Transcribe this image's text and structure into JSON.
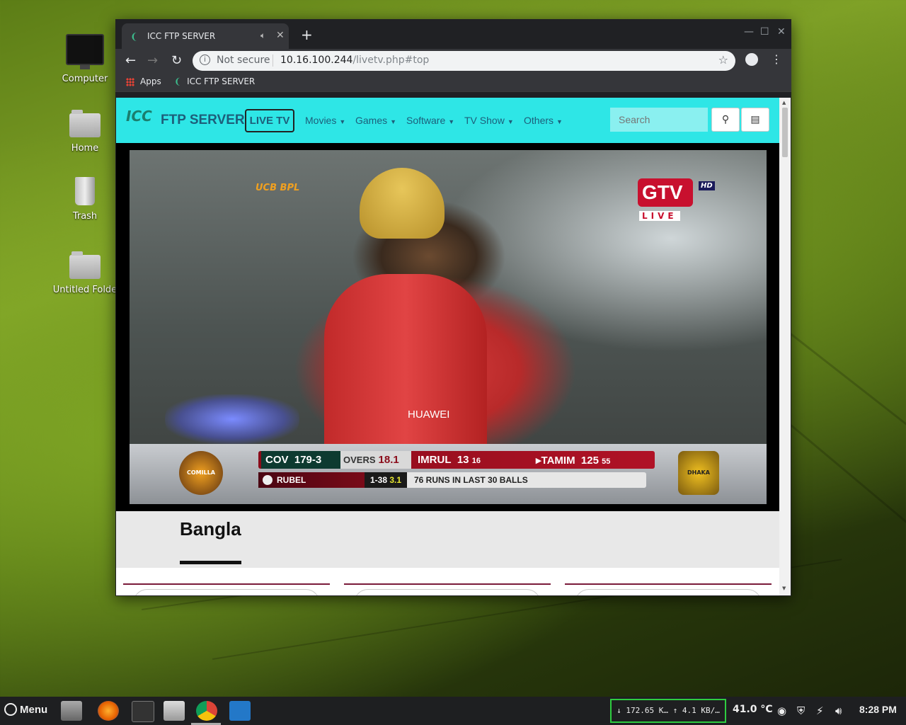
{
  "desktop": {
    "icons": [
      {
        "label": "Computer"
      },
      {
        "label": "Home"
      },
      {
        "label": "Trash"
      },
      {
        "label": "Untitled Folde"
      }
    ]
  },
  "browser": {
    "tab_title": "ICC FTP SERVER",
    "tab_audio_icon": "speaker-icon",
    "new_tab_label": "+",
    "security_label": "Not secure",
    "url_host": "10.16.100.244",
    "url_path": "/livetv.php#top",
    "bookmarks": [
      {
        "label": "Apps"
      },
      {
        "label": "ICC FTP SERVER"
      }
    ]
  },
  "site": {
    "logo_text": "ICC",
    "brand": "FTP SERVER",
    "live_tv": "LIVE TV",
    "nav": [
      {
        "label": "Movies"
      },
      {
        "label": "Games"
      },
      {
        "label": "Software"
      },
      {
        "label": "TV Show"
      },
      {
        "label": "Others"
      }
    ],
    "search_placeholder": "Search",
    "section_title": "Bangla"
  },
  "video": {
    "channel": "GTV",
    "channel_hd": "HD",
    "channel_live": "LIVE",
    "league_logo": "UCB BPL",
    "sponsor": "HUAWEI",
    "team_left": "COMILLA",
    "team_right": "DHAKA DYNAMITES",
    "score": {
      "team": "COV",
      "total": "179-3",
      "overs_label": "OVERS",
      "overs": "18.1",
      "batsman1": "IMRUL",
      "batsman1_runs": "13",
      "batsman1_balls": "16",
      "batsman2": "▸TAMIM",
      "batsman2_runs": "125",
      "batsman2_balls": "55",
      "bowler": "RUBEL",
      "bowler_figures": "1-38",
      "bowler_overs": "3.1",
      "info": "76 RUNS IN LAST 30 BALLS"
    }
  },
  "taskbar": {
    "menu_label": "Menu",
    "net_speed": "↓ 172.65 K… ↑  4.1 KB/…",
    "temperature": "41.0 °C",
    "clock": "8:28 PM"
  }
}
